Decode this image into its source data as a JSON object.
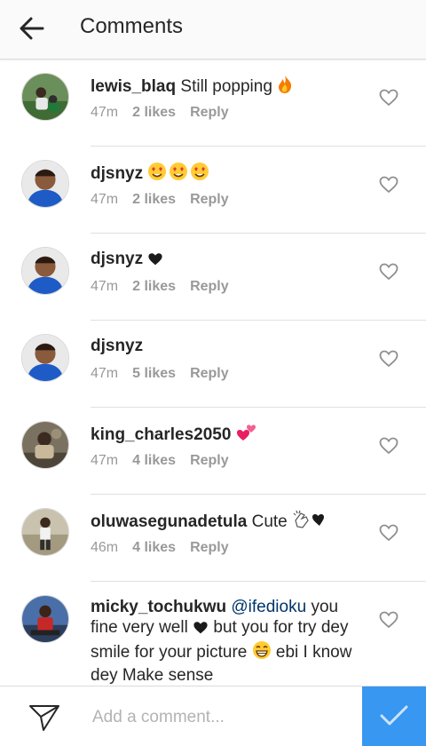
{
  "header": {
    "title": "Comments",
    "back_icon": "arrow-left-icon"
  },
  "comments": [
    {
      "username": "lewis_blaq",
      "text": "Still popping",
      "emoji": "fire",
      "time": "47m",
      "likes": "2 likes",
      "reply": "Reply"
    },
    {
      "username": "djsnyz",
      "text": "",
      "emoji": "three-heart-eyes",
      "time": "47m",
      "likes": "2 likes",
      "reply": "Reply"
    },
    {
      "username": "djsnyz",
      "text": "",
      "emoji": "black-heart",
      "time": "47m",
      "likes": "2 likes",
      "reply": "Reply"
    },
    {
      "username": "djsnyz",
      "text": "",
      "emoji": "",
      "time": "47m",
      "likes": "5 likes",
      "reply": "Reply"
    },
    {
      "username": "king_charles2050",
      "text": "",
      "emoji": "two-hearts",
      "time": "47m",
      "likes": "4 likes",
      "reply": "Reply"
    },
    {
      "username": "oluwasegunadetula",
      "text": "Cute",
      "emoji": "clapping-hands-heart",
      "time": "46m",
      "likes": "4 likes",
      "reply": "Reply"
    },
    {
      "username": "micky_tochukwu",
      "mention": "@ifedioku",
      "text_a": "you fine very well",
      "text_b": "but you for try dey smile for your picture",
      "text_c": "ebi I know dey Make sense"
    }
  ],
  "footer": {
    "placeholder": "Add a comment...",
    "direct_icon": "paper-plane-icon",
    "post_icon": "checkmark-icon"
  },
  "colors": {
    "accent": "#3897f0",
    "text": "#262626",
    "meta": "#999999",
    "mention": "#003569"
  }
}
